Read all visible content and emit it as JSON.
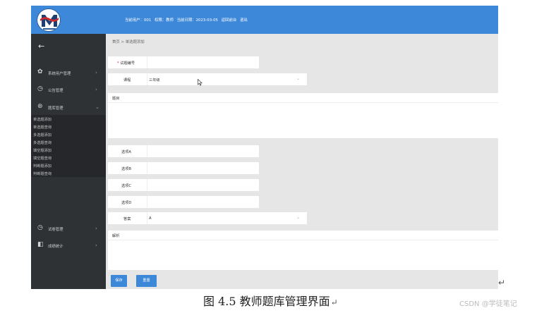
{
  "topbar": {
    "user_label": "当前用户：001",
    "role_label": "权限：教师",
    "date_label": "当前日期：2023-03-05",
    "back_label": "返回前台",
    "logout_label": "退出"
  },
  "sidebar": {
    "back_glyph": "←",
    "menu": [
      {
        "label": "系统用户管理",
        "icon": "gear-icon",
        "glyph": "✿",
        "arrow": "›"
      },
      {
        "label": "公告管理",
        "icon": "clock-icon",
        "glyph": "◷",
        "arrow": "›"
      },
      {
        "label": "题库管理",
        "icon": "question-icon",
        "glyph": "⊛",
        "arrow": "⌄",
        "expanded": true
      }
    ],
    "submenu": [
      "单选题添加",
      "单选题查询",
      "多选题添加",
      "多选题查询",
      "填空题添加",
      "填空题查询",
      "判断题添加",
      "判断题查询"
    ],
    "menu_bottom": [
      {
        "label": "试卷管理",
        "icon": "clock-icon",
        "glyph": "◷",
        "arrow": "›"
      },
      {
        "label": "成绩统计",
        "icon": "chart-icon",
        "glyph": "◧",
        "arrow": "›"
      }
    ]
  },
  "main": {
    "breadcrumb": "首页 > 单选题添加",
    "fields": {
      "question_no": {
        "label": "试题编号",
        "required_mark": "*",
        "value": ""
      },
      "course": {
        "label": "课程",
        "value": "三年级",
        "chevron": "⌄"
      },
      "stem": {
        "label": "题目"
      },
      "option_a": {
        "label": "选项A",
        "value": ""
      },
      "option_b": {
        "label": "选项B",
        "value": ""
      },
      "option_c": {
        "label": "选项C",
        "value": ""
      },
      "option_d": {
        "label": "选项D",
        "value": ""
      },
      "answer": {
        "label": "答案",
        "value": "A",
        "chevron": "⌄"
      },
      "analysis": {
        "label": "解析"
      }
    },
    "buttons": {
      "save": "保存",
      "reset": "重置"
    }
  },
  "caption": {
    "text": "图 4.5 教师题库管理界面",
    "mark": "↵"
  },
  "watermark": "CSDN @学徒笔记",
  "colors": {
    "accent": "#3d88d9",
    "sidebar": "#2f3235",
    "submenu": "#25272a",
    "main_bg": "#e6e6e6"
  }
}
